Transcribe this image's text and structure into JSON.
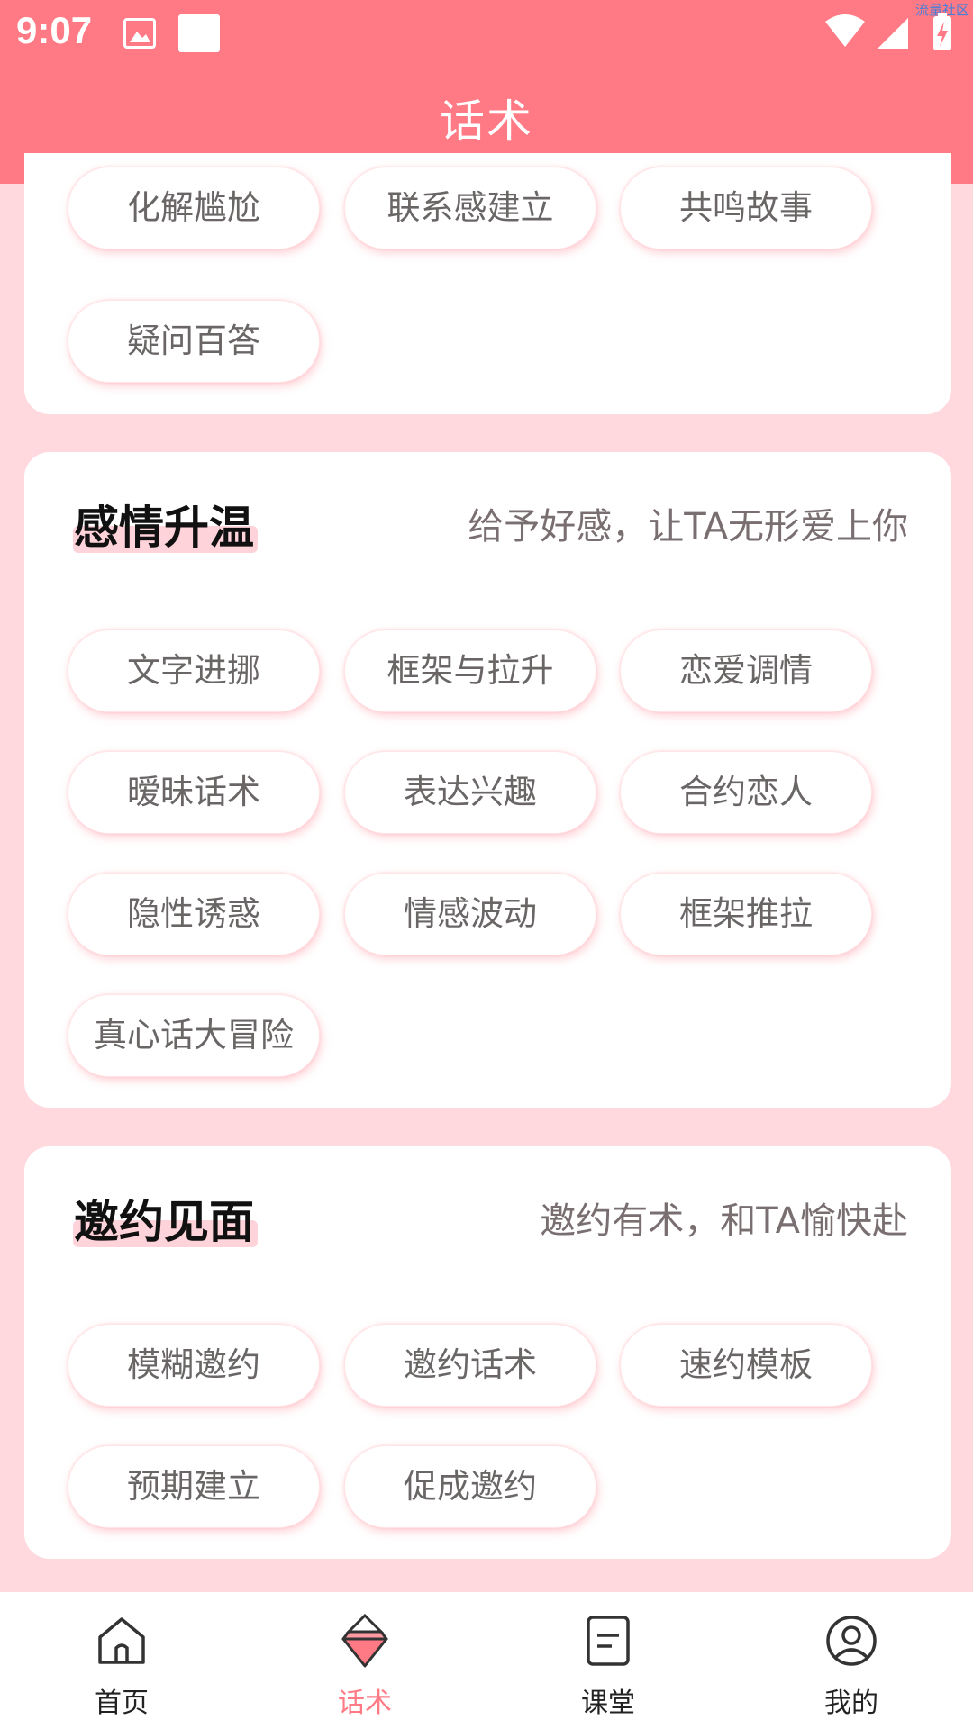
{
  "status": {
    "time": "9:07",
    "watermark": "流量社区"
  },
  "header": {
    "title": "话术"
  },
  "section_top": {
    "chips": [
      "化解尴尬",
      "联系感建立",
      "共鸣故事",
      "疑问百答"
    ]
  },
  "section_warm": {
    "title": "感情升温",
    "subtitle": "给予好感，让TA无形爱上你",
    "chips": [
      "文字进挪",
      "框架与拉升",
      "恋爱调情",
      "暧昧话术",
      "表达兴趣",
      "合约恋人",
      "隐性诱惑",
      "情感波动",
      "框架推拉",
      "真心话大冒险"
    ]
  },
  "section_invite": {
    "title": "邀约见面",
    "subtitle": "邀约有术，和TA愉快赴",
    "chips": [
      "模糊邀约",
      "邀约话术",
      "速约模板",
      "预期建立",
      "促成邀约"
    ]
  },
  "tabs": [
    {
      "label": "首页",
      "icon": "home-icon",
      "active": false
    },
    {
      "label": "话术",
      "icon": "speech-icon",
      "active": true
    },
    {
      "label": "课堂",
      "icon": "classroom-icon",
      "active": false
    },
    {
      "label": "我的",
      "icon": "profile-icon",
      "active": false
    }
  ],
  "colors": {
    "accent": "#ff7a85",
    "background": "#ffd9de",
    "chip_text": "#6a6666"
  }
}
